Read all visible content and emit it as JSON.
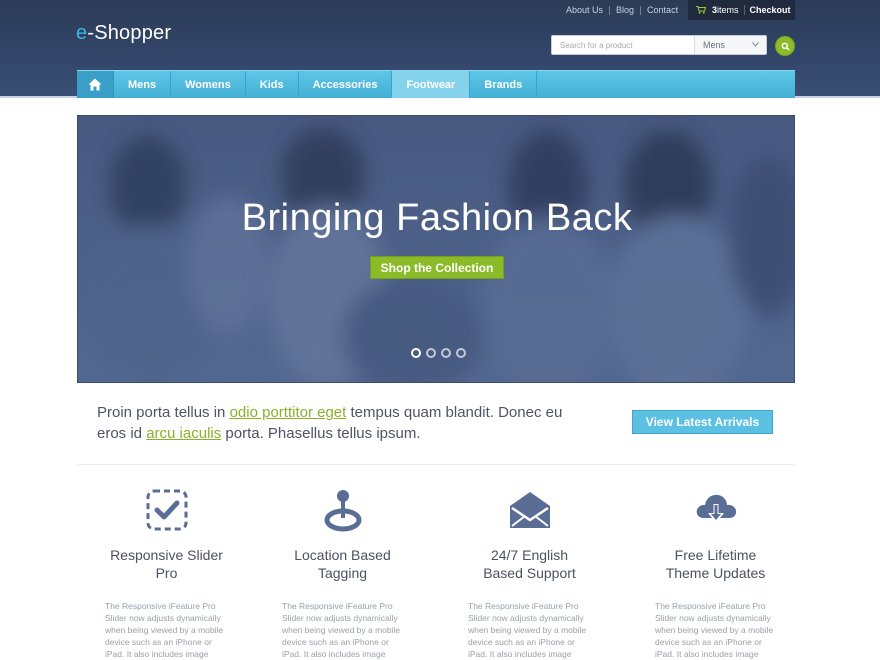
{
  "brand": {
    "logo_prefix": "e",
    "logo_rest": "-Shopper"
  },
  "toplinks": [
    "About Us",
    "Blog",
    "Contact"
  ],
  "cart": {
    "items": "3",
    "items_suffix": " items",
    "checkout": "Checkout"
  },
  "search": {
    "placeholder": "Search for a product",
    "category": "Mens"
  },
  "nav": {
    "items": [
      "Mens",
      "Womens",
      "Kids",
      "Accessories",
      "Footwear",
      "Brands"
    ],
    "active": "Footwear"
  },
  "hero": {
    "title": "Bringing Fashion Back",
    "button": "Shop the Collection",
    "slides": 4,
    "active_slide": 1
  },
  "intro": {
    "t1": "Proin porta tellus in ",
    "link1": "odio porttitor eget",
    "t2": " tempus quam blandit. Donec eu eros id ",
    "link2": "arcu iaculis",
    "t3": " porta. Phasellus tellus ipsum.",
    "button": "View Latest Arrivals"
  },
  "features": [
    {
      "icon": "checkbox-icon",
      "title_line1": "Responsive Slider",
      "title_line2": "Pro",
      "desc": [
        "The Responsive iFeature Pro",
        "Slider now adjusts dynamically",
        "when being viewed by a mobile",
        "device such as an iPhone or",
        "iPad. It also includes image"
      ]
    },
    {
      "icon": "map-pin-icon",
      "title_line1": "Location Based",
      "title_line2": "Tagging",
      "desc": [
        "The Responsive iFeature Pro",
        "Slider now adjusts dynamically",
        "when being viewed by a mobile",
        "device such as an iPhone or",
        "iPad. It also includes image"
      ]
    },
    {
      "icon": "envelope-icon",
      "title_line1": "24/7 English",
      "title_line2": "Based Support",
      "desc": [
        "The Responsive iFeature Pro",
        "Slider now adjusts dynamically",
        "when being viewed by a mobile",
        "device such as an iPhone or",
        "iPad. It also includes image"
      ]
    },
    {
      "icon": "cloud-download-icon",
      "title_line1": "Free Lifetime",
      "title_line2": "Theme Updates",
      "desc": [
        "The Responsive iFeature Pro",
        "Slider now adjusts dynamically",
        "when being viewed by a mobile",
        "device such as an iPhone or",
        "iPad. It also includes image"
      ]
    }
  ],
  "colors": {
    "header": "#2c3b57",
    "nav": "#43b0d6",
    "accent_green": "#8cbb29",
    "accent_blue": "#5cc0e3",
    "icon": "#5a6d94"
  }
}
